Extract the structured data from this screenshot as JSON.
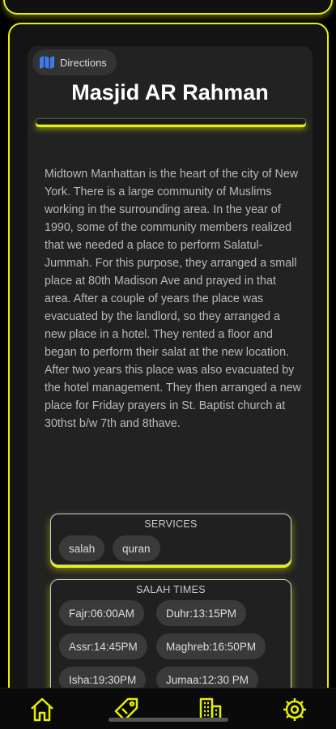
{
  "colors": {
    "accent": "#e6f000",
    "background": "#000000",
    "panel": "#222222",
    "chip": "#3a3a3a"
  },
  "directions": {
    "label": "Directions",
    "icon": "map-icon"
  },
  "masjid": {
    "name": "Masjid AR Rahman",
    "description": "Midtown Manhattan is the heart of the city of New York. There is a large community of Muslims working in the surrounding area. In the year of 1990, some of the community members realized that we needed a place to perform Salatul-Jummah. For this purpose, they arranged a small place at 80th Madison Ave and prayed in that area. After a couple of years the place was evacuated by the landlord, so they arranged a new place in a hotel. They rented a floor and began to perform their salat at the new location. After two years this place was also evacuated by the hotel management. They then arranged a new place for Friday prayers in St. Baptist church at 30thst b/w 7th and 8thave."
  },
  "services": {
    "title": "SERVICES",
    "items": [
      "salah",
      "quran"
    ]
  },
  "salah_times": {
    "title": "SALAH TIMES",
    "items": [
      "Fajr:06:00AM",
      "Duhr:13:15PM",
      "Assr:14:45PM",
      "Maghreb:16:50PM",
      "Isha:19:30PM",
      "Jumaa:12:30 PM"
    ]
  },
  "nav": {
    "items": [
      "home-icon",
      "tag-icon",
      "buildings-icon",
      "settings-icon"
    ]
  }
}
